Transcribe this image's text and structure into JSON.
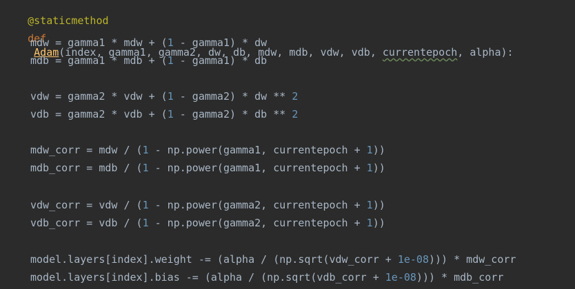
{
  "code": {
    "decorator": "@staticmethod",
    "def_keyword": "def",
    "function_name": "Adam",
    "params_before": "(index, gamma1, gamma2, dw, db, mdw, mdb, vdw, vdb, ",
    "param_squiggle": "currentepoch",
    "params_after": ", alpha):",
    "lines": {
      "mdw": {
        "a": "mdw = gamma1 * mdw + (",
        "n1": "1",
        "b": " - gamma1) * dw"
      },
      "mdb": {
        "a": "mdb = gamma1 * mdb + (",
        "n1": "1",
        "b": " - gamma1) * db"
      },
      "vdw": {
        "a": "vdw = gamma2 * vdw + (",
        "n1": "1",
        "b": " - gamma2) * dw ** ",
        "n2": "2"
      },
      "vdb": {
        "a": "vdb = gamma2 * vdb + (",
        "n1": "1",
        "b": " - gamma2) * db ** ",
        "n2": "2"
      },
      "mdw_corr": {
        "a": "mdw_corr = mdw / (",
        "n1": "1",
        "b": " - np.power(gamma1, currentepoch + ",
        "n2": "1",
        "c": "))"
      },
      "mdb_corr": {
        "a": "mdb_corr = mdb / (",
        "n1": "1",
        "b": " - np.power(gamma1, currentepoch + ",
        "n2": "1",
        "c": "))"
      },
      "vdw_corr": {
        "a": "vdw_corr = vdw / (",
        "n1": "1",
        "b": " - np.power(gamma2, currentepoch + ",
        "n2": "1",
        "c": "))"
      },
      "vdb_corr": {
        "a": "vdb_corr = vdb / (",
        "n1": "1",
        "b": " - np.power(gamma2, currentepoch + ",
        "n2": "1",
        "c": "))"
      },
      "weight": {
        "a": "model.layers[index].weight -= (alpha / (np.sqrt(vdw_corr + ",
        "n1": "1e-08",
        "b": "))) * mdw_corr"
      },
      "bias": {
        "a": "model.layers[index].bias -= (alpha / (np.sqrt(vdb_corr + ",
        "n1": "1e-08",
        "b": "))) * mdb_corr"
      }
    }
  },
  "colors": {
    "background": "#2b2b2b",
    "text": "#a9b7c6",
    "keyword": "#cc7832",
    "decorator": "#bbb529",
    "function": "#ffc66d",
    "number": "#6897bb"
  }
}
